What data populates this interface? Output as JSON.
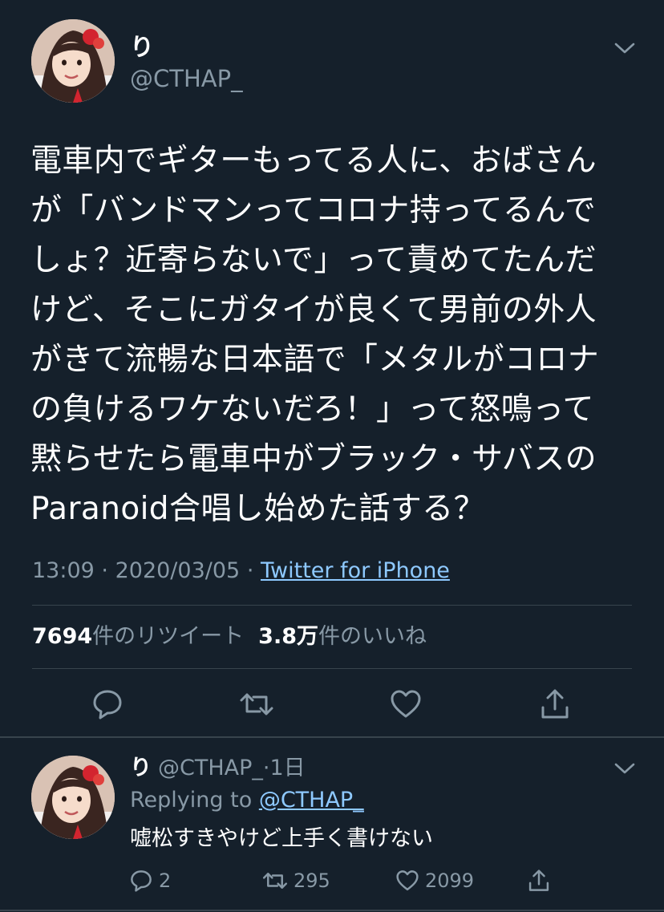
{
  "tweet": {
    "display_name": "り",
    "handle": "@CTHAP_",
    "body_lines": [
      "電車内でギターもってる人に、おばさん",
      "が「バンドマンってコロナ持ってるんで",
      "しょ？近寄らないで」って責めてたんだ",
      "けど、そこにガタイが良くて男前の外人",
      "がきて流暢な日本語で「メタルがコロナ",
      "の負けるワケないだろ！」って怒鳴って",
      "黙らせたら電車中がブラック・サバスの",
      "Paranoid合唱し始めた話する？"
    ],
    "time": "13:09",
    "date": "2020/03/05",
    "dot": "·",
    "source": "Twitter for iPhone",
    "retweet_count": "7694",
    "retweet_label": "件のリツイート",
    "like_count": "3.8万",
    "like_label": "件のいいね",
    "icons": [
      "reply-icon",
      "retweet-icon",
      "like-icon",
      "share-icon",
      "chevron-down-icon"
    ]
  },
  "reply": {
    "display_name": "り",
    "handle": "@CTHAP_",
    "separator": "·",
    "time_ago": "1日",
    "replying_label": "Replying to",
    "replying_to": "@CTHAP_",
    "text": "嘘松すきやけど上手く書けない",
    "reply_count": "2",
    "retweet_count": "295",
    "like_count": "2099"
  },
  "colors": {
    "background": "#15202b",
    "secondary_text": "#8899a6",
    "link": "#8ec9ff",
    "divider": "#38444d"
  }
}
